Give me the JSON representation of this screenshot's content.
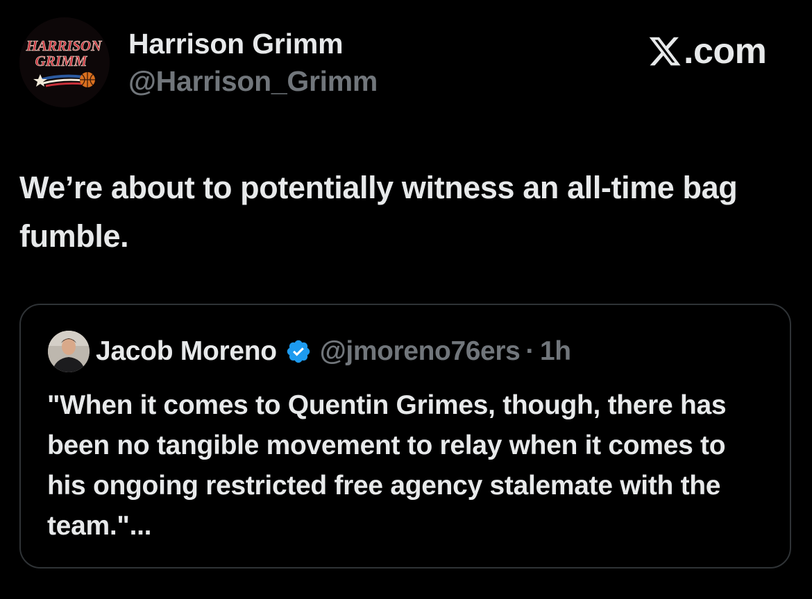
{
  "post": {
    "author": {
      "name": "Harrison Grimm",
      "handle": "@Harrison_Grimm",
      "avatar_logo_line1": "HARRISON",
      "avatar_logo_line2": "GRIMM"
    },
    "brand": {
      "label": ".com",
      "icon": "x-logo-icon"
    },
    "text": "We’re about to potentially witness an all-time bag fumble.",
    "quoted_post": {
      "author_name": "Jacob Moreno",
      "verified_icon": "verified-badge-icon",
      "handle": "@jmoreno76ers",
      "separator": "·",
      "time": "1h",
      "text": "\"When it comes to Quentin Grimes, though, there has been no tangible movement to relay when it comes to his ongoing restricted free agency stalemate with the team.\"..."
    }
  },
  "colors": {
    "background": "#000000",
    "primary_text": "#e7e9ea",
    "secondary_text": "#71767b",
    "card_border": "#2f3336",
    "verified": "#1d9bf0",
    "logo_red": "#b3222a"
  }
}
